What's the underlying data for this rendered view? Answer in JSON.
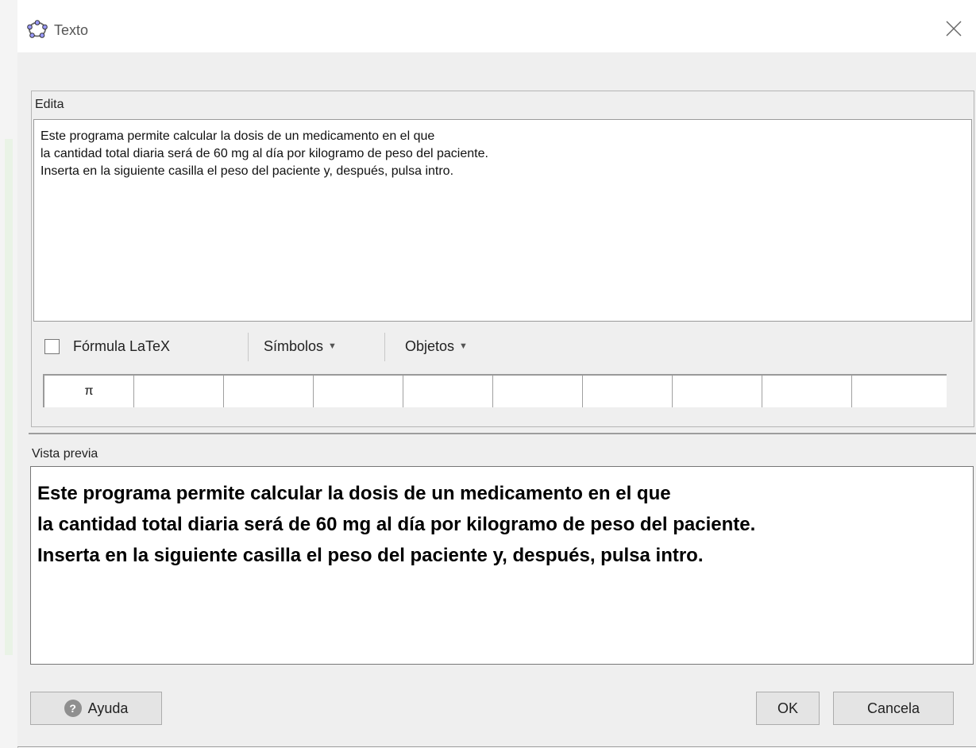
{
  "window": {
    "title": "Texto"
  },
  "edit": {
    "label": "Edita",
    "lines": [
      "Este programa permite calcular la dosis de un medicamento en el que",
      "la cantidad total diaria será de 60 mg al día por kilogramo de peso del paciente.",
      "Inserta en la siguiente casilla el peso del paciente y, después, pulsa intro."
    ]
  },
  "toolbar": {
    "latex_label": "Fórmula LaTeX",
    "latex_checked": false,
    "symbols_label": "Símbolos",
    "objects_label": "Objetos"
  },
  "symbols": [
    "π",
    "",
    "",
    "",
    "",
    "",
    "",
    "",
    "",
    ""
  ],
  "preview": {
    "label": "Vista previa",
    "lines": [
      "Este programa permite calcular la dosis de un medicamento en el que",
      "la cantidad total diaria será de 60 mg al día por kilogramo de peso del paciente.",
      "Inserta en la siguiente casilla el peso del paciente y, después, pulsa intro."
    ]
  },
  "buttons": {
    "help": "Ayuda",
    "ok": "OK",
    "cancel": "Cancela"
  },
  "icons": {
    "title": "geogebra-icon",
    "close": "close-icon",
    "help": "help-icon",
    "caret": "caret-down-icon"
  }
}
